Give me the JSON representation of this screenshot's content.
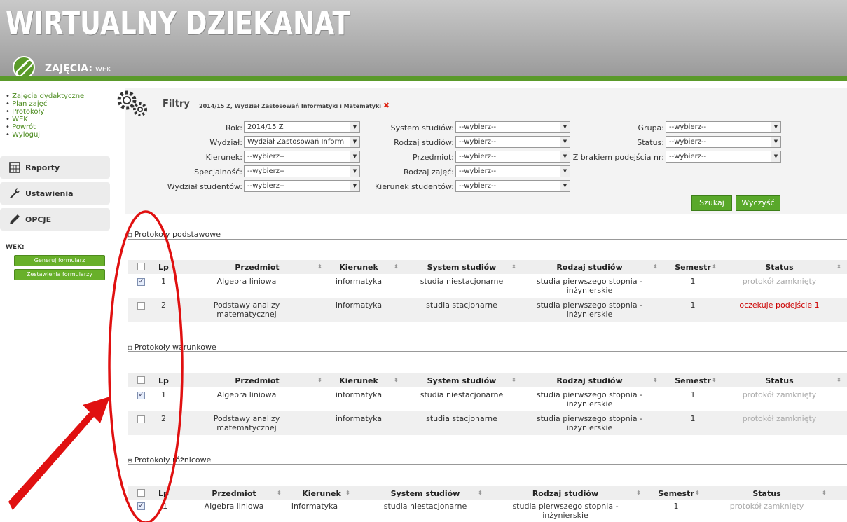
{
  "header": {
    "brand": "WIRTUALNY DZIEKANAT",
    "section": "ZAJĘCIA:",
    "section_sub": "WEK"
  },
  "sidebar": {
    "menu": [
      "Zajęcia dydaktyczne",
      "Plan zajęć",
      "Protokoły",
      "WEK",
      "Powrót",
      "Wyloguj"
    ],
    "raporty": "Raporty",
    "ustawienia": "Ustawienia",
    "opcje": "OPCJE",
    "wek_label": "WEK:",
    "btn_generuj": "Generuj formularz",
    "btn_zestawienia": "Zestawienia formularzy"
  },
  "filters": {
    "title": "Filtry",
    "subtitle": "2014/15 Z,  Wydział Zastosowań Informatyki i Matematyki",
    "rok_label": "Rok:",
    "rok_value": "2014/15 Z",
    "wydzial_label": "Wydział:",
    "wydzial_value": "Wydział Zastosowań Inform",
    "kierunek_label": "Kierunek:",
    "kierunek_value": "--wybierz--",
    "specjalnosc_label": "Specjalność:",
    "specjalnosc_value": "--wybierz--",
    "wydzial_stud_label": "Wydział studentów:",
    "wydzial_stud_value": "--wybierz--",
    "system_label": "System studiów:",
    "system_value": "--wybierz--",
    "rodzaj_stud_label": "Rodzaj studiów:",
    "rodzaj_stud_value": "--wybierz--",
    "przedmiot_label": "Przedmiot:",
    "przedmiot_value": "--wybierz--",
    "rodzaj_zajec_label": "Rodzaj zajęć:",
    "rodzaj_zajec_value": "--wybierz--",
    "kierunek_stud_label": "Kierunek studentów:",
    "kierunek_stud_value": "--wybierz--",
    "grupa_label": "Grupa:",
    "grupa_value": "--wybierz--",
    "status_label": "Status:",
    "status_value": "--wybierz--",
    "podejscie_label": "Z brakiem podejścia nr:",
    "podejscie_value": "--wybierz--",
    "szukaj": "Szukaj",
    "wyczysc": "Wyczyść"
  },
  "columns": {
    "lp": "Lp",
    "przedmiot": "Przedmiot",
    "kierunek": "Kierunek",
    "system": "System studiów",
    "rodzaj": "Rodzaj studiów",
    "semestr": "Semestr",
    "status": "Status"
  },
  "groups": [
    {
      "title": "Protokoły podstawowe",
      "rows": [
        {
          "lp": "1",
          "przedmiot": "Algebra liniowa",
          "kierunek": "informatyka",
          "system": "studia niestacjonarne",
          "rodzaj1": "studia pierwszego stopnia -",
          "rodzaj2": "inżynierskie",
          "semestr": "1",
          "status": "protokół zamknięty"
        },
        {
          "lp": "2",
          "przedmiot": "Podstawy analizy matematycznej",
          "kierunek": "informatyka",
          "system": "studia stacjonarne",
          "rodzaj1": "studia pierwszego stopnia -",
          "rodzaj2": "inżynierskie",
          "semestr": "1",
          "status": "oczekuje podejście 1"
        }
      ]
    },
    {
      "title": "Protokoły warunkowe",
      "rows": [
        {
          "lp": "1",
          "przedmiot": "Algebra liniowa",
          "kierunek": "informatyka",
          "system": "studia niestacjonarne",
          "rodzaj1": "studia pierwszego stopnia -",
          "rodzaj2": "inżynierskie",
          "semestr": "1",
          "status": "protokół zamknięty"
        },
        {
          "lp": "2",
          "przedmiot": "Podstawy analizy matematycznej",
          "kierunek": "informatyka",
          "system": "studia stacjonarne",
          "rodzaj1": "studia pierwszego stopnia -",
          "rodzaj2": "inżynierskie",
          "semestr": "1",
          "status": "protokół zamknięty"
        }
      ]
    },
    {
      "title": "Protokoły różnicowe",
      "rows": [
        {
          "lp": "1",
          "przedmiot": "Algebra liniowa",
          "kierunek": "informatyka",
          "system": "studia niestacjonarne",
          "rodzaj1": "studia pierwszego stopnia -",
          "rodzaj2": "inżynierskie",
          "semestr": "1",
          "status": "protokół zamknięty"
        }
      ]
    }
  ],
  "colors": {
    "accent_green": "#5a9a2a",
    "status_red": "#cc0000",
    "annotation_red": "#e01010"
  }
}
